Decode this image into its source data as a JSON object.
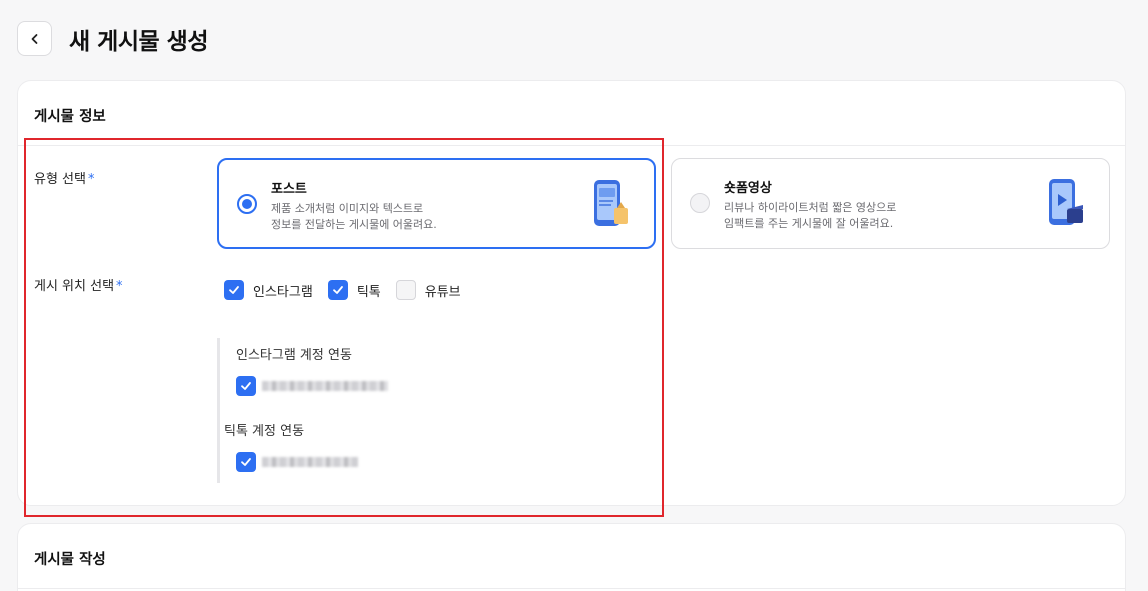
{
  "header": {
    "title": "새 게시물 생성"
  },
  "section_info": {
    "title": "게시물 정보",
    "type_label": "유형 선택",
    "required_mark": "*",
    "options": [
      {
        "title": "포스트",
        "desc1": "제품 소개처럼 이미지와 텍스트로",
        "desc2": "정보를 전달하는 게시물에 어울려요.",
        "selected": true
      },
      {
        "title": "숏폼영상",
        "desc1": "리뷰나 하이라이트처럼 짧은 영상으로",
        "desc2": "임팩트를 주는 게시물에 잘 어울려요.",
        "selected": false
      }
    ],
    "location_label": "게시 위치 선택",
    "locations": [
      {
        "label": "인스타그램",
        "checked": true
      },
      {
        "label": "틱톡",
        "checked": true
      },
      {
        "label": "유튜브",
        "checked": false
      }
    ],
    "instagram_link_label": "인스타그램 계정 연동",
    "tiktok_link_label": "틱톡 계정 연동"
  },
  "section_write": {
    "title": "게시물 작성"
  },
  "colors": {
    "accent": "#2d6ff2",
    "highlight": "#e0262c"
  }
}
